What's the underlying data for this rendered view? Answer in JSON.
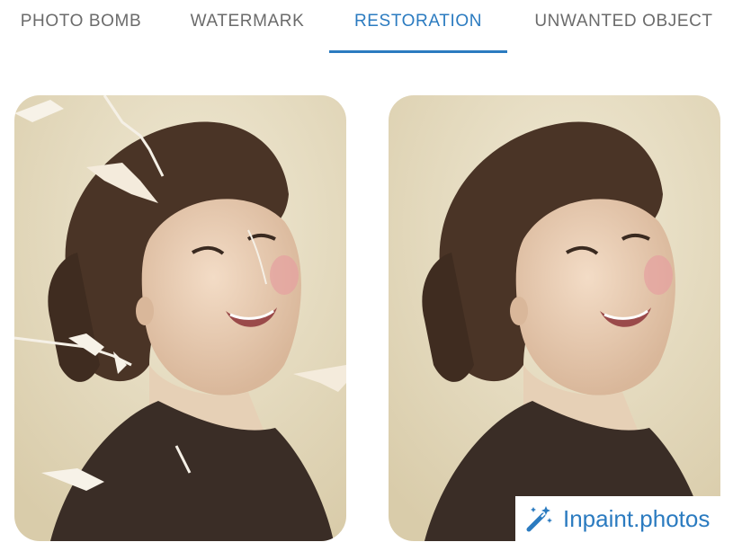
{
  "tabs": [
    {
      "label": "PHOTO BOMB",
      "active": false
    },
    {
      "label": "WATERMARK",
      "active": false
    },
    {
      "label": "RESTORATION",
      "active": true
    },
    {
      "label": "UNWANTED OBJECT",
      "active": false
    }
  ],
  "images": {
    "before": {
      "alt": "Damaged old portrait with cracks and tears"
    },
    "after": {
      "alt": "Restored old portrait"
    }
  },
  "brand": {
    "name": "Inpaint.photos",
    "icon": "magic-wand-icon"
  },
  "colors": {
    "accent": "#2b7bc0",
    "tab_text": "#6b6b6b",
    "sepia_bg": "#ebe2c9"
  }
}
